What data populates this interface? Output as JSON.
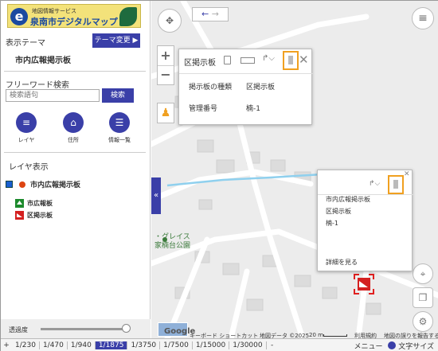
{
  "logo": {
    "sub": "地図情報サービス",
    "main": "泉南市デジタルマップ"
  },
  "theme": {
    "label": "表示テーマ",
    "button": "テーマ変更 ▶",
    "current": "市内広報掲示板"
  },
  "freeword": {
    "label": "フリーワード検索",
    "placeholder": "検索語句",
    "button": "検索"
  },
  "nav": [
    {
      "label": "レイヤ",
      "icon": "layers-icon",
      "glyph": "≡"
    },
    {
      "label": "住所",
      "icon": "house-icon",
      "glyph": "⌂"
    },
    {
      "label": "情報一覧",
      "icon": "list-icon",
      "glyph": "☰"
    }
  ],
  "layers": {
    "title": "レイヤ表示",
    "main_layer": "市内広報掲示板",
    "legend": [
      "市広報板",
      "区掲示板"
    ]
  },
  "opacity_label": "透過度",
  "opacity_value": 1.0,
  "scales": {
    "plus": "+",
    "items": [
      "1/230",
      "1/470",
      "1/940",
      "1/1875",
      "1/3750",
      "1/7500",
      "1/15000",
      "1/30000"
    ],
    "active": "1/1875",
    "minus": "-",
    "menu": "メニュー",
    "textsize": "文字サイズ"
  },
  "popup1": {
    "title": "区掲示板",
    "row1_key": "掲示板の種類",
    "row1_val": "区掲示板",
    "row2_key": "管理番号",
    "row2_val": "楠-1"
  },
  "popup2": {
    "line1": "市内広報掲示板",
    "line2": "区掲示板",
    "line3": "楠-1",
    "link": "詳細を見る"
  },
  "map": {
    "poi": "・グレイス\n家楠台公園",
    "google": "Google",
    "shortcuts": "キーボード ショートカット",
    "mapdata": "地図データ ©2025",
    "scale": "20 m",
    "terms": "利用規約",
    "report": "地図の誤りを報告する"
  },
  "colors": {
    "accent": "#3a3fa8",
    "highlight": "#f0a020",
    "marker": "#e02020"
  }
}
